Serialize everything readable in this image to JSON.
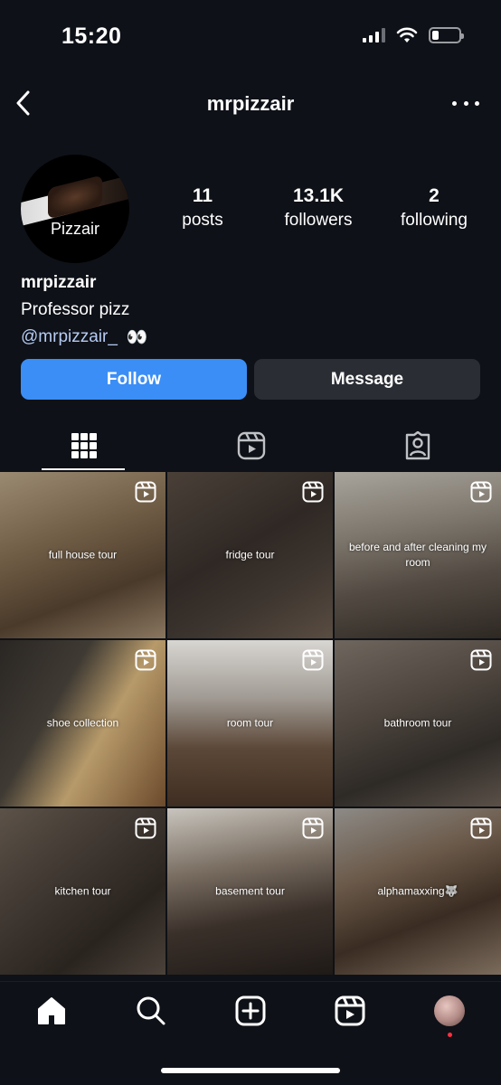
{
  "status": {
    "time": "15:20"
  },
  "header": {
    "title": "mrpizzair"
  },
  "profile": {
    "avatar_label": "Pizzair",
    "stats": [
      {
        "num": "11",
        "label": "posts"
      },
      {
        "num": "13.1K",
        "label": "followers"
      },
      {
        "num": "2",
        "label": "following"
      }
    ],
    "name": "mrpizzair",
    "description": "Professor pizz",
    "handle": "@mrpizzair_",
    "handle_emoji": "👀"
  },
  "actions": {
    "follow": "Follow",
    "message": "Message"
  },
  "tabs": [
    {
      "icon": "grid-icon",
      "active": true
    },
    {
      "icon": "reels-icon",
      "active": false
    },
    {
      "icon": "tagged-icon",
      "active": false
    }
  ],
  "posts": [
    {
      "caption": "full house tour"
    },
    {
      "caption": "fridge tour"
    },
    {
      "caption": "before and after cleaning my room"
    },
    {
      "caption": "shoe collection"
    },
    {
      "caption": "room tour"
    },
    {
      "caption": "bathroom tour"
    },
    {
      "caption": "kitchen tour"
    },
    {
      "caption": "basement tour"
    },
    {
      "caption": "alphamaxxing🐺"
    }
  ],
  "bottom_nav": [
    {
      "icon": "home-icon",
      "active": true
    },
    {
      "icon": "search-icon",
      "active": false
    },
    {
      "icon": "create-icon",
      "active": false
    },
    {
      "icon": "reels-icon",
      "active": false
    },
    {
      "icon": "profile-avatar",
      "active": false
    }
  ],
  "colors": {
    "follow_button": "#3b8ef5",
    "message_button": "#2a2d33",
    "background": "#0e1117",
    "link": "#b6cbf3",
    "notification_dot": "#ff3040"
  }
}
